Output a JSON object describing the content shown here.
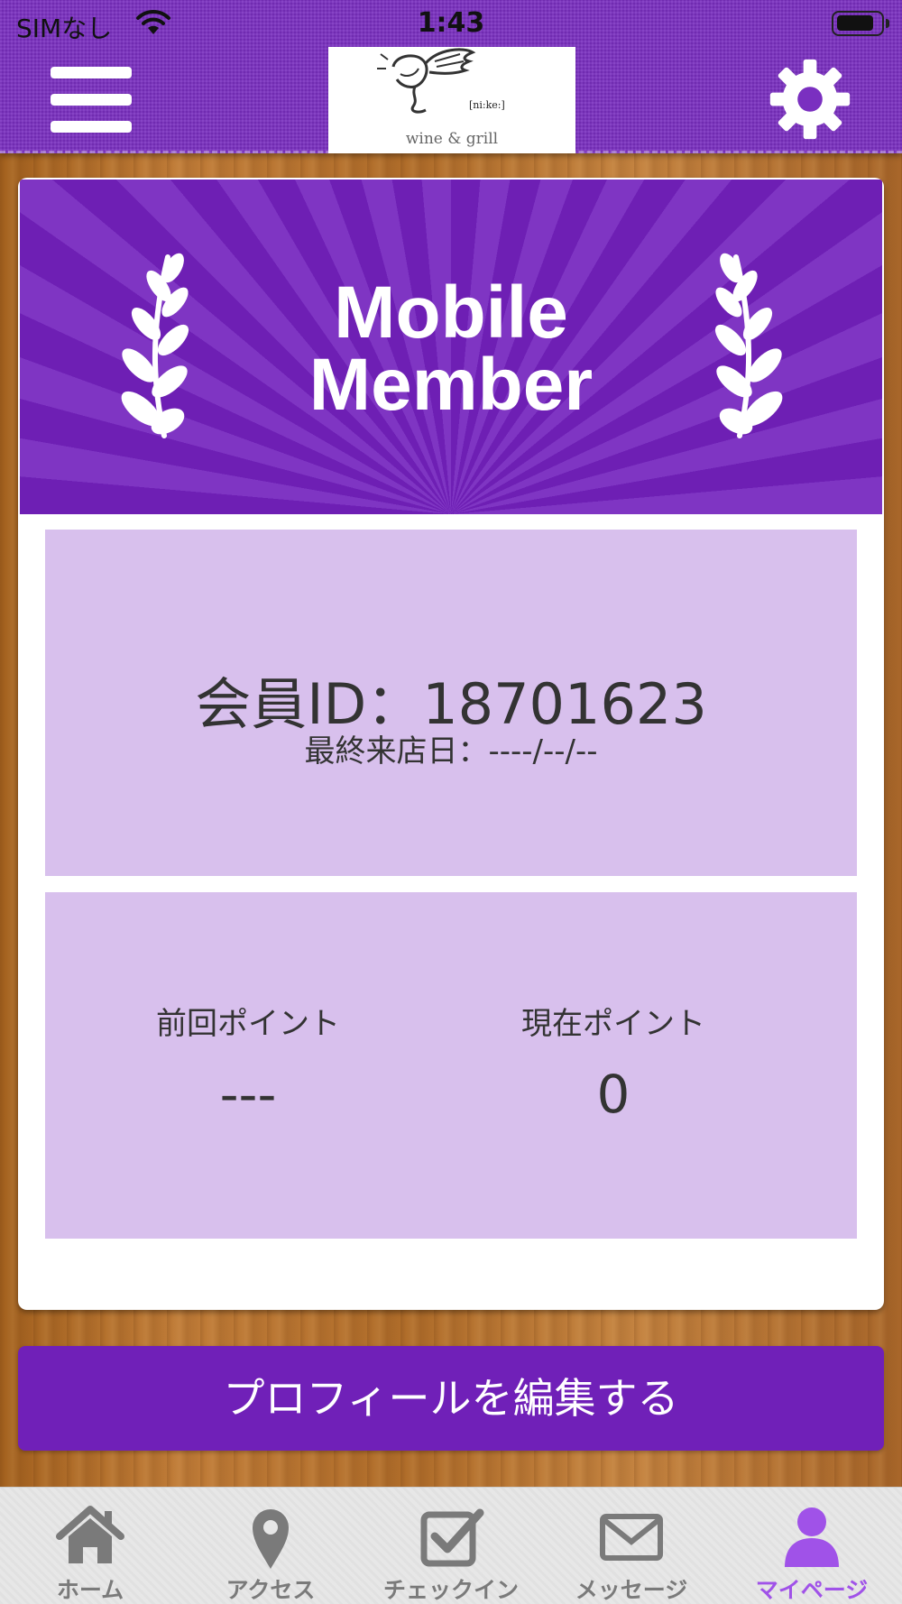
{
  "status_bar": {
    "carrier": "SIMなし",
    "time": "1:43"
  },
  "header": {
    "logo_tagline": "wine & grill",
    "logo_small_text": "[ni:ke:]"
  },
  "banner": {
    "line1": "Mobile",
    "line2": "Member"
  },
  "member": {
    "id_text": "会員ID：18701623",
    "last_visit_text": "最終来店日：----/--/--"
  },
  "points": {
    "previous_label": "前回ポイント",
    "previous_value": "---",
    "current_label": "現在ポイント",
    "current_value": "0"
  },
  "profile_button": {
    "label": "プロフィールを編集する"
  },
  "tabs": [
    {
      "label": "ホーム",
      "icon": "home-icon",
      "active": false
    },
    {
      "label": "アクセス",
      "icon": "map-pin-icon",
      "active": false
    },
    {
      "label": "チェックイン",
      "icon": "checkbox-icon",
      "active": false
    },
    {
      "label": "メッセージ",
      "icon": "envelope-icon",
      "active": false
    },
    {
      "label": "マイページ",
      "icon": "user-icon",
      "active": true
    }
  ],
  "colors": {
    "header_purple": "#7a2fc0",
    "banner_purple": "#6e1fb4",
    "box_lavender": "#d8c0ed",
    "button_purple": "#7020b8",
    "tab_active": "#a052e8",
    "tab_inactive": "#7a7a7a"
  }
}
